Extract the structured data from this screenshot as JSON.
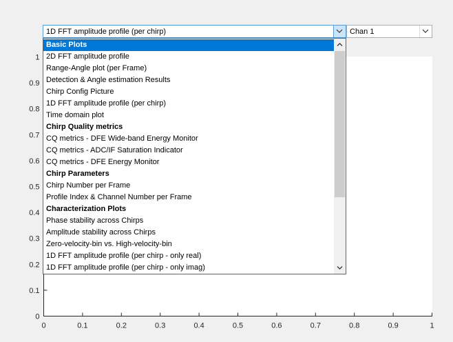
{
  "plot_select": {
    "value": "1D FFT amplitude profile (per chirp)",
    "expanded": true,
    "options": [
      {
        "label": "Basic Plots",
        "header": true,
        "selected": true
      },
      {
        "label": "2D FFT amplitude profile",
        "header": false,
        "selected": false
      },
      {
        "label": "Range-Angle plot (per Frame)",
        "header": false,
        "selected": false
      },
      {
        "label": "Detection & Angle estimation Results",
        "header": false,
        "selected": false
      },
      {
        "label": "Chirp Config Picture",
        "header": false,
        "selected": false
      },
      {
        "label": "1D FFT amplitude profile (per chirp)",
        "header": false,
        "selected": false
      },
      {
        "label": "Time domain plot",
        "header": false,
        "selected": false
      },
      {
        "label": "Chirp Quality metrics",
        "header": true,
        "selected": false
      },
      {
        "label": "CQ metrics - DFE Wide-band Energy Monitor",
        "header": false,
        "selected": false
      },
      {
        "label": "CQ metrics - ADC/IF Saturation Indicator",
        "header": false,
        "selected": false
      },
      {
        "label": "CQ metrics - DFE Energy Monitor",
        "header": false,
        "selected": false
      },
      {
        "label": "Chirp Parameters",
        "header": true,
        "selected": false
      },
      {
        "label": "Chirp Number per Frame",
        "header": false,
        "selected": false
      },
      {
        "label": "Profile Index & Channel Number per Frame",
        "header": false,
        "selected": false
      },
      {
        "label": "Characterization Plots",
        "header": true,
        "selected": false
      },
      {
        "label": "Phase stability across Chirps",
        "header": false,
        "selected": false
      },
      {
        "label": "Amplitude stability across Chirps",
        "header": false,
        "selected": false
      },
      {
        "label": "Zero-velocity-bin vs. High-velocity-bin",
        "header": false,
        "selected": false
      },
      {
        "label": "1D FFT amplitude profile (per chirp - only real)",
        "header": false,
        "selected": false
      },
      {
        "label": "1D FFT amplitude profile (per chirp - only imag)",
        "header": false,
        "selected": false
      }
    ],
    "scroll_position": 0
  },
  "channel_select": {
    "value": "Chan 1"
  },
  "axes": {
    "x_ticks": [
      "0",
      "0.1",
      "0.2",
      "0.3",
      "0.4",
      "0.5",
      "0.6",
      "0.7",
      "0.8",
      "0.9",
      "1"
    ],
    "y_ticks": [
      "0",
      "0.1",
      "0.2",
      "0.3",
      "0.4",
      "0.5",
      "0.6",
      "0.7",
      "0.8",
      "0.9",
      "1"
    ],
    "xlim": [
      0,
      1
    ],
    "ylim": [
      0,
      1
    ],
    "grid": false
  },
  "colors": {
    "selected_item_bg": "#0078d7",
    "axis_color": "#262626",
    "figure_bg": "#f0f0f0"
  }
}
